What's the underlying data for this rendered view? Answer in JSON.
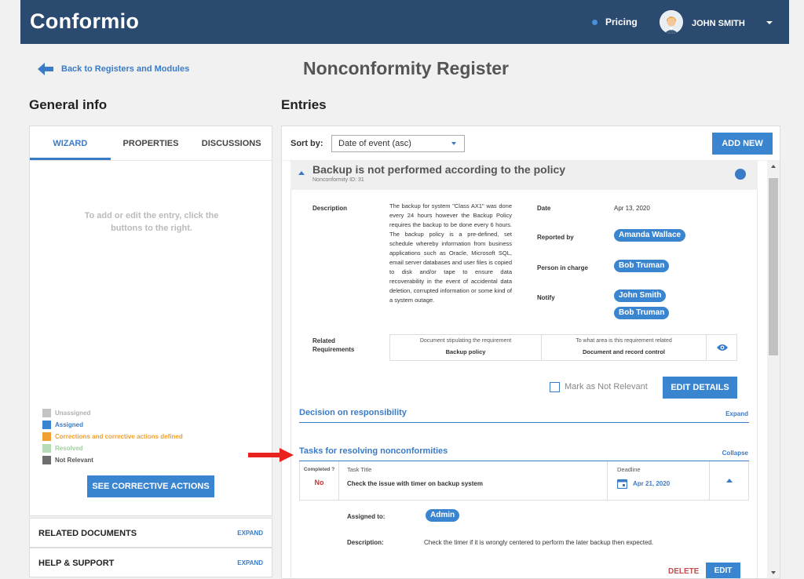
{
  "app": {
    "brand": "Conformio"
  },
  "header": {
    "pricing": "Pricing",
    "user_name": "JOHN SMITH"
  },
  "nav": {
    "back_label": "Back to Registers and Modules"
  },
  "page": {
    "title": "Nonconformity Register"
  },
  "left": {
    "heading": "General info",
    "tabs": [
      "WIZARD",
      "PROPERTIES",
      "DISCUSSIONS"
    ],
    "hint": "To add or edit the entry, click the buttons to the right.",
    "legend": [
      {
        "label": "Unassigned",
        "color": "#c4c4c4",
        "text_color": "#b0b0b0"
      },
      {
        "label": "Assigned",
        "color": "#3a85d0",
        "text_color": "#3a7bc8"
      },
      {
        "label": "Corrections and corrective actions defined",
        "color": "#f0a030",
        "text_color": "#f0a030"
      },
      {
        "label": "Resolved",
        "color": "#b6dbb6",
        "text_color": "#9fcf9f"
      },
      {
        "label": "Not Relevant",
        "color": "#6e6e6e",
        "text_color": "#555555"
      }
    ],
    "see_ca_label": "SEE CORRECTIVE ACTIONS",
    "accordions": [
      {
        "title": "RELATED DOCUMENTS",
        "action": "EXPAND"
      },
      {
        "title": "HELP & SUPPORT",
        "action": "EXPAND"
      }
    ]
  },
  "right": {
    "heading": "Entries",
    "sort_label": "Sort by:",
    "sort_value": "Date of event (asc)",
    "add_new": "ADD NEW",
    "entry": {
      "title": "Backup is not performed according to the policy",
      "id": "Nonconformity ID: 31",
      "description_label": "Description",
      "description": "The backup for system \"Class AX1\" was done every 24 hours however the Backup Policy requires the backup to be done every 6 hours. The backup policy is a pre-defined, set schedule whereby information from business applications such as Oracle, Microsoft SQL, email server databases and user files is copied to disk and/or tape to ensure data recoverability in the event of accidental data deletion, corrupted information or some kind of a system outage.",
      "date_label": "Date",
      "date": "Apr 13, 2020",
      "reported_label": "Reported by",
      "reported_by": "Amanda Wallace",
      "person_label": "Person in charge",
      "person": "Bob Truman",
      "notify_label": "Notify",
      "notify": [
        "John Smith",
        "Bob Truman"
      ],
      "related_label": "Related Requirements",
      "req_head_1": "Document stipulating the requirement",
      "req_val_1": "Backup policy",
      "req_head_2": "To what area is this requirement related",
      "req_val_2": "Document and record control",
      "not_relevant_label": "Mark as Not Relevant",
      "edit_details": "EDIT DETAILS"
    },
    "decision": {
      "title": "Decision on responsibility",
      "action": "Expand"
    },
    "tasks": {
      "title": "Tasks for resolving nonconformities",
      "action": "Collapse",
      "completed_head": "Completed ?",
      "completed_val": "No",
      "task_head": "Task Title",
      "task_val": "Check the issue with timer on backup system",
      "deadline_head": "Deadline",
      "deadline_val": "Apr 21, 2020",
      "assigned_label": "Assigned to:",
      "assigned_val": "Admin",
      "desc_label": "Description:",
      "desc_val": "Check the timer if it is wrongly centered to perform the later backup then expected.",
      "delete": "DELETE",
      "edit": "EDIT"
    }
  }
}
